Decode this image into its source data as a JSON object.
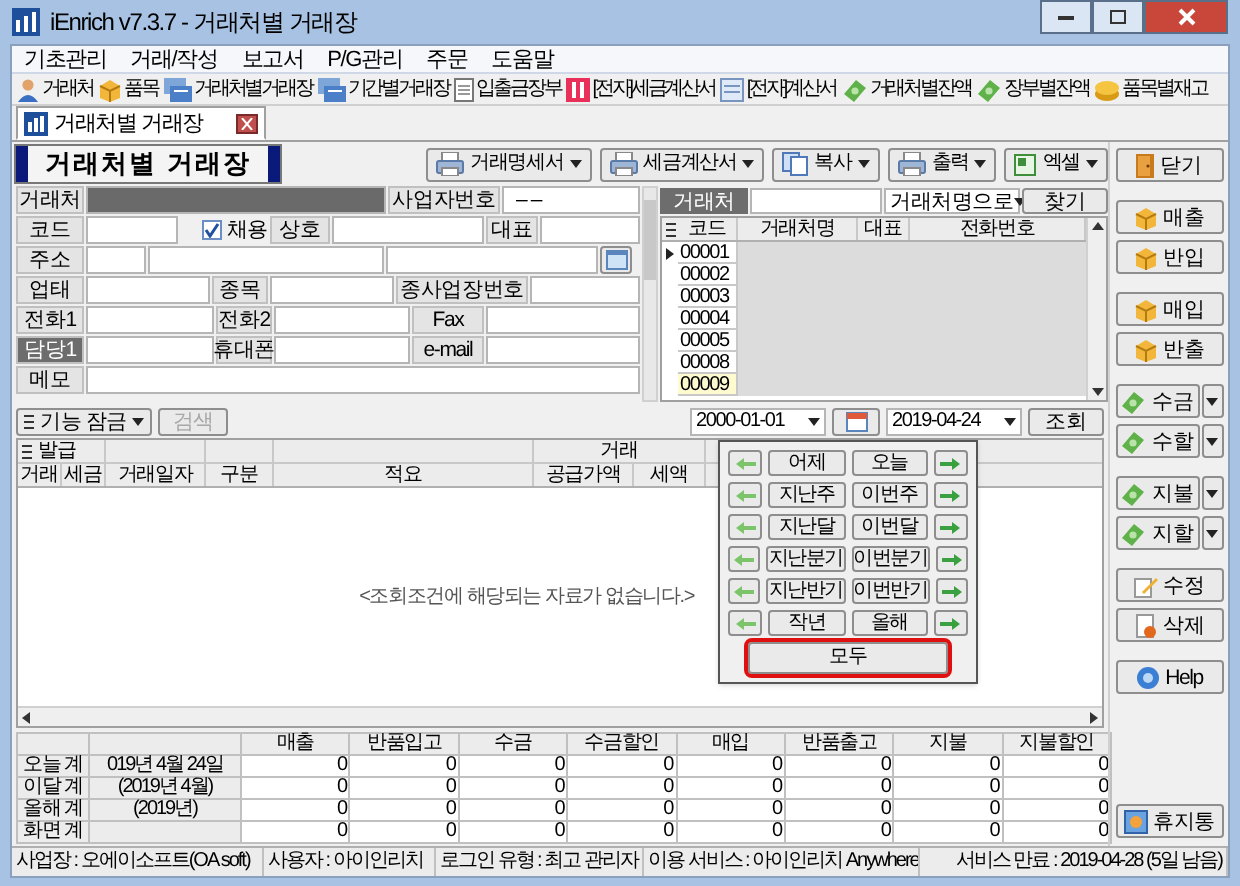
{
  "window": {
    "title": "iEnrich v7.3.7 - 거래처별 거래장"
  },
  "menu": [
    "기초관리",
    "거래/작성",
    "보고서",
    "P/G관리",
    "주문",
    "도움말"
  ],
  "toolbar": [
    {
      "label": "거래처",
      "kind": "person"
    },
    {
      "label": "품목",
      "kind": "box"
    },
    {
      "label": "거래처별거래장",
      "kind": "ledger"
    },
    {
      "label": "기간별거래장",
      "kind": "ledger"
    },
    {
      "label": "입출금장부",
      "kind": "notepad"
    },
    {
      "label": "[전자]세금계산서",
      "kind": "redbook"
    },
    {
      "label": "[전자]계산서",
      "kind": "sheet"
    },
    {
      "label": "거래처별잔액",
      "kind": "money"
    },
    {
      "label": "장부별잔액",
      "kind": "money"
    },
    {
      "label": "품목별재고",
      "kind": "coins"
    }
  ],
  "tabs": [
    {
      "label": "거래처별 거래장",
      "selected": true
    }
  ],
  "page_title": "거래처별 거래장",
  "actions": [
    {
      "label": "거래명세서",
      "kind": "printer"
    },
    {
      "label": "세금계산서",
      "kind": "printer"
    },
    {
      "label": "복사",
      "kind": "copy"
    },
    {
      "label": "출력",
      "kind": "printer"
    },
    {
      "label": "엑셀",
      "kind": "excel"
    }
  ],
  "form": [
    [
      {
        "kind": "label",
        "text": "거래처"
      },
      {
        "kind": "field",
        "masked": true
      },
      {
        "kind": "label",
        "text": "사업자번호"
      },
      {
        "kind": "field",
        "value": "–   –"
      }
    ],
    [
      {
        "kind": "label",
        "text": "코드"
      },
      {
        "kind": "field"
      },
      {
        "kind": "check",
        "text": "채용",
        "checked": true
      },
      {
        "kind": "label",
        "text": "상호"
      },
      {
        "kind": "field"
      },
      {
        "kind": "label",
        "text": "대표"
      },
      {
        "kind": "field"
      }
    ],
    [
      {
        "kind": "label",
        "text": "주소"
      },
      {
        "kind": "field"
      },
      {
        "kind": "field"
      },
      {
        "kind": "field"
      },
      {
        "kind": "lookup"
      }
    ],
    [
      {
        "kind": "label",
        "text": "업태"
      },
      {
        "kind": "field"
      },
      {
        "kind": "label",
        "text": "종목"
      },
      {
        "kind": "field"
      },
      {
        "kind": "label",
        "text": "종사업장번호"
      },
      {
        "kind": "field"
      }
    ],
    [
      {
        "kind": "label",
        "text": "전화1"
      },
      {
        "kind": "field"
      },
      {
        "kind": "label",
        "text": "전화2"
      },
      {
        "kind": "field"
      },
      {
        "kind": "label",
        "text": "Fax"
      },
      {
        "kind": "field"
      }
    ],
    [
      {
        "kind": "label",
        "text": "담당1",
        "highlighted": true
      },
      {
        "kind": "field"
      },
      {
        "kind": "label",
        "text": "휴대폰"
      },
      {
        "kind": "field"
      },
      {
        "kind": "label",
        "text": "e-mail"
      },
      {
        "kind": "field"
      }
    ],
    [
      {
        "kind": "label",
        "text": "메모"
      },
      {
        "kind": "field"
      }
    ]
  ],
  "customer_list": {
    "search_label": "거래처",
    "search_mode": "거래처명으로",
    "find_button": "찾기",
    "columns": [
      "코드",
      "거래처명",
      "대표",
      "전화번호"
    ],
    "rows": [
      {
        "code": "00001",
        "current": true,
        "selected": false
      },
      {
        "code": "00002",
        "current": false,
        "selected": false
      },
      {
        "code": "00003",
        "current": false,
        "selected": false
      },
      {
        "code": "00004",
        "current": false,
        "selected": false
      },
      {
        "code": "00005",
        "current": false,
        "selected": false
      },
      {
        "code": "00008",
        "current": false,
        "selected": false
      },
      {
        "code": "00009",
        "current": false,
        "selected": true
      }
    ]
  },
  "tools": {
    "lock_button": "기능 잠금",
    "search_button": {
      "label": "검색",
      "disabled": true
    },
    "date_from": "2000-01-01",
    "date_to": "2019-04-24",
    "query_button": "조회"
  },
  "table": {
    "group_headers": [
      "발급",
      "거래"
    ],
    "columns": [
      "거래",
      "세금",
      "거래일자",
      "구분",
      "적요",
      "공급가액",
      "세액"
    ],
    "empty_message": "<조회조건에 해당되는 자료가 없습니다.>"
  },
  "period_popup": {
    "rows": [
      [
        "어제",
        "오늘"
      ],
      [
        "지난주",
        "이번주"
      ],
      [
        "지난달",
        "이번달"
      ],
      [
        "지난분기",
        "이번분기"
      ],
      [
        "지난반기",
        "이번반기"
      ],
      [
        "작년",
        "올해"
      ]
    ],
    "all_button": {
      "label": "모두",
      "highlighted": true
    }
  },
  "summary": {
    "columns": [
      "매출",
      "반품입고",
      "수금",
      "수금할인",
      "매입",
      "반품출고",
      "지불",
      "지불할인"
    ],
    "rows": [
      {
        "label": "오늘 계",
        "period": "019년 4월 24일",
        "values": [
          "0",
          "0",
          "0",
          "0",
          "0",
          "0",
          "0",
          "0"
        ]
      },
      {
        "label": "이달 계",
        "period": "(2019년 4월)",
        "values": [
          "0",
          "0",
          "0",
          "0",
          "0",
          "0",
          "0",
          "0"
        ]
      },
      {
        "label": "올해 계",
        "period": "(2019년)",
        "values": [
          "0",
          "0",
          "0",
          "0",
          "0",
          "0",
          "0",
          "0"
        ]
      },
      {
        "label": "화면 계",
        "values": [
          "0",
          "0",
          "0",
          "0",
          "0",
          "0",
          "0",
          "0"
        ]
      }
    ]
  },
  "side_groups": [
    [
      {
        "label": "닫기",
        "kind": "door"
      }
    ],
    [
      {
        "label": "매출",
        "kind": "box"
      },
      {
        "label": "반입",
        "kind": "box"
      }
    ],
    [
      {
        "label": "매입",
        "kind": "box"
      },
      {
        "label": "반출",
        "kind": "box"
      }
    ],
    [
      {
        "label": "수금",
        "kind": "money",
        "dropdown": true
      },
      {
        "label": "수할",
        "kind": "money",
        "dropdown": true
      }
    ],
    [
      {
        "label": "지불",
        "kind": "money",
        "dropdown": true
      },
      {
        "label": "지할",
        "kind": "money",
        "dropdown": true
      }
    ],
    [
      {
        "label": "수정",
        "kind": "pencil"
      },
      {
        "label": "삭제",
        "kind": "docdel"
      }
    ],
    [
      {
        "label": "Help",
        "kind": "help"
      }
    ]
  ],
  "trash_button": {
    "label": "휴지통",
    "kind": "trash"
  },
  "status_bar": [
    "사업장 : 오에이소프트(OA soft)",
    "사용자 : 아이인리치",
    "로그인 유형 : 최고 관리자",
    "이용 서비스 : 아이인리치 Anywhere",
    "서비스 만료 : 2019-04-28 (5일 남음)"
  ]
}
